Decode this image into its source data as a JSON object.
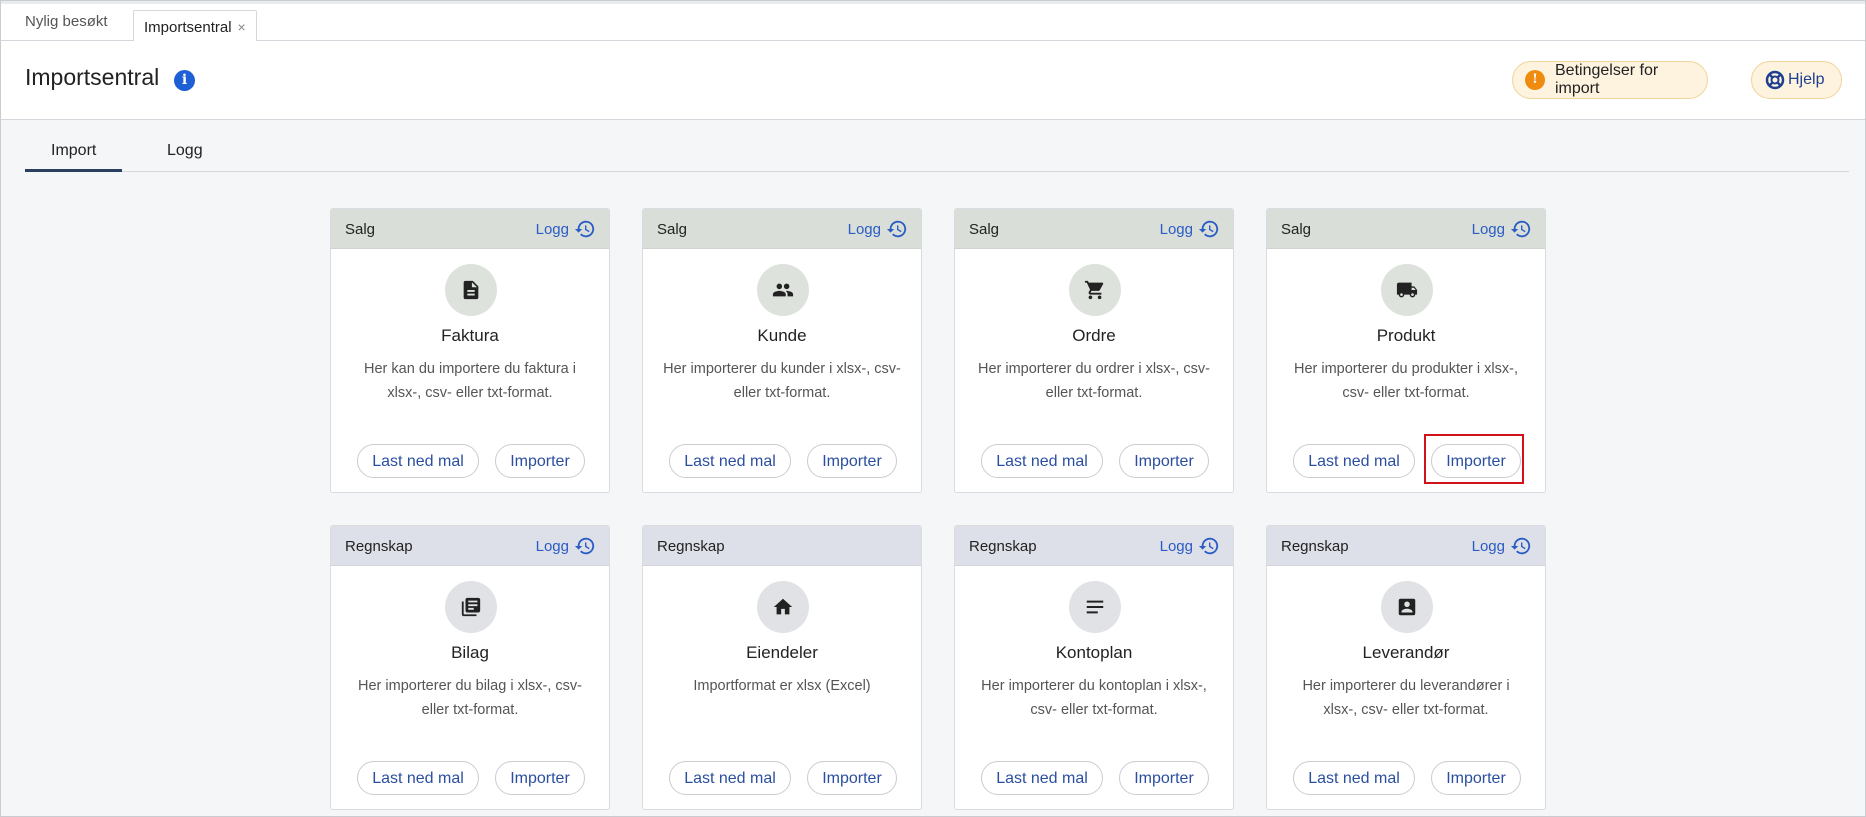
{
  "tabs": {
    "recent": "Nylig besøkt",
    "active": "Importsentral",
    "close": "×"
  },
  "header": {
    "title": "Importsentral",
    "info_icon": "i",
    "conditions_button": "Betingelser for import",
    "conditions_icon": "!",
    "help_button": "Hjelp"
  },
  "subtabs": {
    "import": "Import",
    "logg": "Logg"
  },
  "cards": [
    {
      "category": "Salg",
      "log": "Logg",
      "icon": "document-icon",
      "title": "Faktura",
      "desc": "Her kan du importere du faktura i xlsx-, csv- eller txt-format.",
      "download": "Last ned mal",
      "import": "Importer"
    },
    {
      "category": "Salg",
      "log": "Logg",
      "icon": "people-icon",
      "title": "Kunde",
      "desc": "Her importerer du kunder i xlsx-, csv- eller txt-format.",
      "download": "Last ned mal",
      "import": "Importer"
    },
    {
      "category": "Salg",
      "log": "Logg",
      "icon": "cart-icon",
      "title": "Ordre",
      "desc": "Her importerer du ordrer i xlsx-, csv- eller txt-format.",
      "download": "Last ned mal",
      "import": "Importer"
    },
    {
      "category": "Salg",
      "log": "Logg",
      "icon": "truck-icon",
      "title": "Produkt",
      "desc": "Her importerer du produkter i xlsx-, csv- eller txt-format.",
      "download": "Last ned mal",
      "import": "Importer"
    },
    {
      "category": "Regnskap",
      "log": "Logg",
      "icon": "library-books-icon",
      "title": "Bilag",
      "desc": "Her importerer du bilag i xlsx-, csv- eller txt-format.",
      "download": "Last ned mal",
      "import": "Importer"
    },
    {
      "category": "Regnskap",
      "log": "",
      "icon": "home-icon",
      "title": "Eiendeler",
      "desc": "Importformat er xlsx (Excel)",
      "download": "Last ned mal",
      "import": "Importer"
    },
    {
      "category": "Regnskap",
      "log": "Logg",
      "icon": "lines-icon",
      "title": "Kontoplan",
      "desc": "Her importerer du kontoplan i xlsx-, csv- eller txt-format.",
      "download": "Last ned mal",
      "import": "Importer"
    },
    {
      "category": "Regnskap",
      "log": "Logg",
      "icon": "contact-card-icon",
      "title": "Leverandør",
      "desc": "Her importerer du leverandører i xlsx-, csv- eller txt-format.",
      "download": "Last ned mal",
      "import": "Importer"
    }
  ],
  "colors": {
    "accent": "#2b5cc4",
    "warning": "#ef8c0f",
    "highlight": "#d0121b"
  }
}
